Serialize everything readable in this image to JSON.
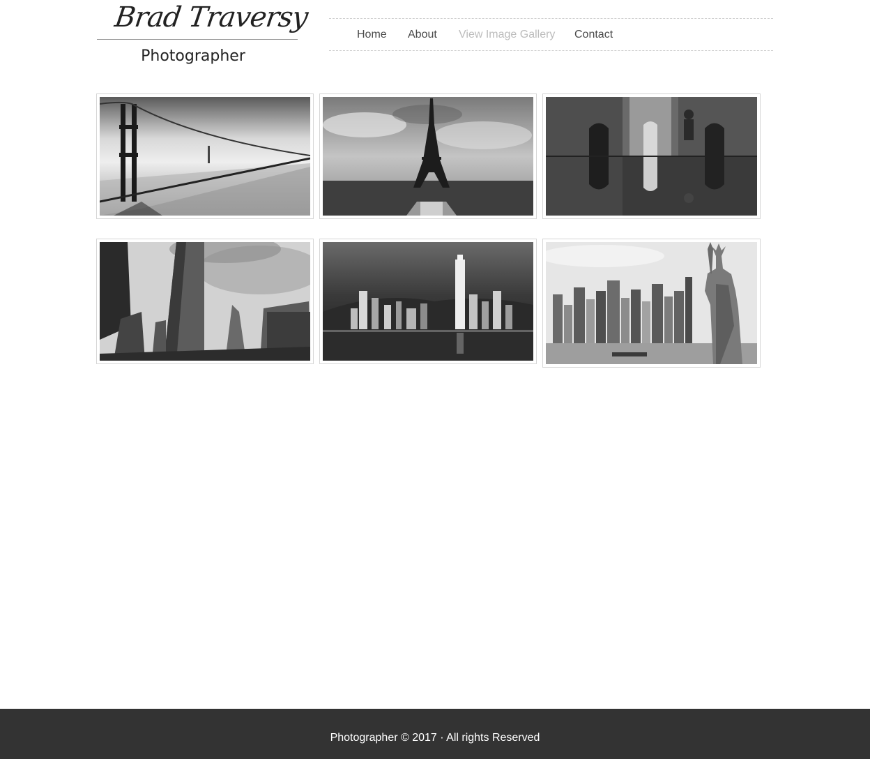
{
  "logo": {
    "name": "Brad Traversy",
    "tagline": "Photographer"
  },
  "nav": {
    "items": [
      {
        "label": "Home",
        "active": false
      },
      {
        "label": "About",
        "active": false
      },
      {
        "label": "View Image Gallery",
        "active": true
      },
      {
        "label": "Contact",
        "active": false
      }
    ]
  },
  "gallery": {
    "images": [
      {
        "subject": "golden-gate-bridge"
      },
      {
        "subject": "eiffel-tower"
      },
      {
        "subject": "street-reflection"
      },
      {
        "subject": "flatiron-building"
      },
      {
        "subject": "hong-kong-skyline"
      },
      {
        "subject": "statue-of-liberty-skyline"
      }
    ]
  },
  "footer": {
    "text": "Photographer © 2017 · All rights Reserved"
  },
  "colors": {
    "footer_bg": "#333333",
    "nav_text": "#4a4a4a",
    "nav_active": "#bcbcbc",
    "thumb_border": "#d6d6d6"
  }
}
